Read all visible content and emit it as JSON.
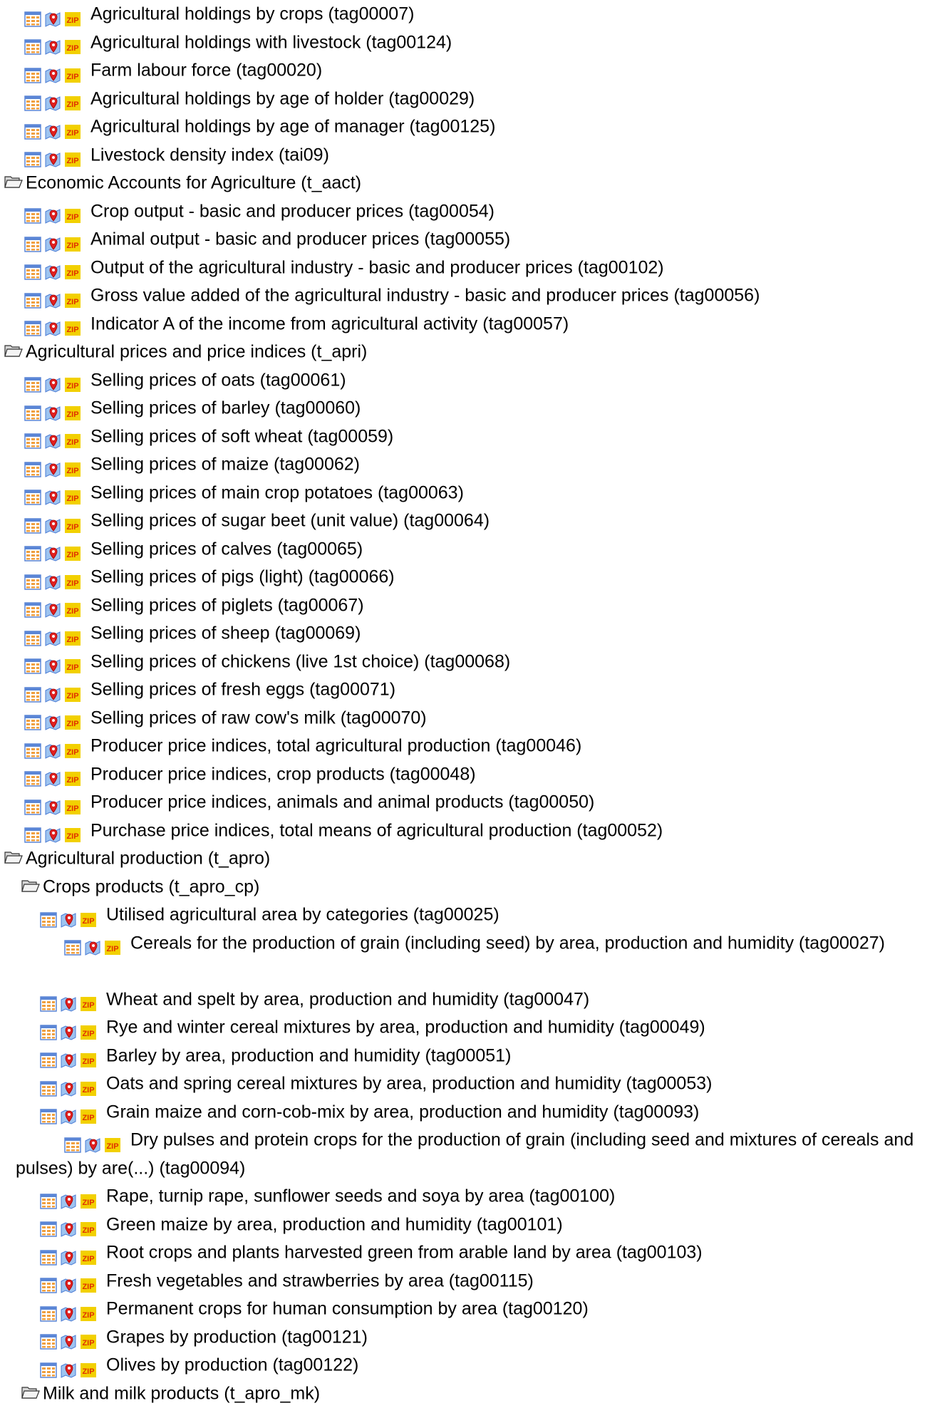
{
  "tree": [
    {
      "type": "leaf",
      "level": 1,
      "label": "Agricultural holdings by crops (tag00007)"
    },
    {
      "type": "leaf",
      "level": 1,
      "label": "Agricultural holdings with livestock (tag00124)"
    },
    {
      "type": "leaf",
      "level": 1,
      "label": "Farm labour force (tag00020)"
    },
    {
      "type": "leaf",
      "level": 1,
      "label": "Agricultural holdings by age of holder (tag00029)"
    },
    {
      "type": "leaf",
      "level": 1,
      "label": "Agricultural holdings by age of manager (tag00125)"
    },
    {
      "type": "leaf",
      "level": 1,
      "label": "Livestock density index (tai09)"
    },
    {
      "type": "folder",
      "level": 0,
      "label": "Economic Accounts for Agriculture (t_aact)"
    },
    {
      "type": "leaf",
      "level": 1,
      "label": "Crop output - basic and producer prices (tag00054)"
    },
    {
      "type": "leaf",
      "level": 1,
      "label": "Animal output - basic and producer prices (tag00055)"
    },
    {
      "type": "leaf",
      "level": 1,
      "label": "Output of the agricultural industry - basic and producer prices (tag00102)"
    },
    {
      "type": "leaf",
      "level": 1,
      "label": "Gross value added of the agricultural industry - basic and producer prices (tag00056)"
    },
    {
      "type": "leaf",
      "level": 1,
      "label": "Indicator A of the income from agricultural activity (tag00057)"
    },
    {
      "type": "folder",
      "level": 0,
      "label": "Agricultural prices and price indices (t_apri)"
    },
    {
      "type": "leaf",
      "level": 1,
      "label": "Selling prices of oats (tag00061)"
    },
    {
      "type": "leaf",
      "level": 1,
      "label": "Selling prices of barley (tag00060)"
    },
    {
      "type": "leaf",
      "level": 1,
      "label": "Selling prices of soft wheat (tag00059)"
    },
    {
      "type": "leaf",
      "level": 1,
      "label": "Selling prices of maize (tag00062)"
    },
    {
      "type": "leaf",
      "level": 1,
      "label": "Selling prices of main crop potatoes (tag00063)"
    },
    {
      "type": "leaf",
      "level": 1,
      "label": "Selling prices of sugar beet (unit value) (tag00064)"
    },
    {
      "type": "leaf",
      "level": 1,
      "label": "Selling prices of calves (tag00065)"
    },
    {
      "type": "leaf",
      "level": 1,
      "label": "Selling prices of pigs (light) (tag00066)"
    },
    {
      "type": "leaf",
      "level": 1,
      "label": "Selling prices of piglets (tag00067)"
    },
    {
      "type": "leaf",
      "level": 1,
      "label": "Selling prices of sheep (tag00069)"
    },
    {
      "type": "leaf",
      "level": 1,
      "label": "Selling prices of chickens (live 1st choice) (tag00068)"
    },
    {
      "type": "leaf",
      "level": 1,
      "label": "Selling prices of fresh eggs (tag00071)"
    },
    {
      "type": "leaf",
      "level": 1,
      "label": "Selling prices of raw cow's milk (tag00070)"
    },
    {
      "type": "leaf",
      "level": 1,
      "label": "Producer price indices, total agricultural production (tag00046)"
    },
    {
      "type": "leaf",
      "level": 1,
      "label": "Producer price indices, crop products (tag00048)"
    },
    {
      "type": "leaf",
      "level": 1,
      "label": "Producer price indices, animals and animal products (tag00050)"
    },
    {
      "type": "leaf",
      "level": 1,
      "label": "Purchase price indices, total means of agricultural production (tag00052)"
    },
    {
      "type": "folder",
      "level": 0,
      "label": "Agricultural production (t_apro)"
    },
    {
      "type": "folder",
      "level": 1,
      "label": "Crops products (t_apro_cp)"
    },
    {
      "type": "leaf",
      "level": 2,
      "label": "Utilised agricultural area by categories (tag00025)"
    },
    {
      "type": "leaf",
      "level": 2,
      "wrap": true,
      "label": "Cereals for the production of grain (including seed) by area, production and humidity (tag00027)"
    },
    {
      "type": "leaf",
      "level": 2,
      "label": "Wheat and spelt  by area, production and humidity (tag00047)"
    },
    {
      "type": "leaf",
      "level": 2,
      "label": "Rye and winter cereal mixtures by area, production and humidity (tag00049)"
    },
    {
      "type": "leaf",
      "level": 2,
      "label": "Barley by area, production and humidity (tag00051)"
    },
    {
      "type": "leaf",
      "level": 2,
      "label": "Oats and spring cereal mixtures by area, production and humidity (tag00053)"
    },
    {
      "type": "leaf",
      "level": 2,
      "label": "Grain maize and corn-cob-mix by area, production and humidity (tag00093)"
    },
    {
      "type": "leaf",
      "level": 2,
      "wrap": true,
      "label": "Dry pulses and protein crops for the production of grain (including seed and mixtures of cereals and pulses) by are(...) (tag00094)"
    },
    {
      "type": "leaf",
      "level": 2,
      "label": "Rape, turnip rape, sunflower seeds and soya by area (tag00100)"
    },
    {
      "type": "leaf",
      "level": 2,
      "label": "Green maize by area, production and humidity (tag00101)"
    },
    {
      "type": "leaf",
      "level": 2,
      "label": "Root crops and plants harvested green from arable land by area (tag00103)"
    },
    {
      "type": "leaf",
      "level": 2,
      "label": "Fresh vegetables and strawberries by area (tag00115)"
    },
    {
      "type": "leaf",
      "level": 2,
      "label": "Permanent crops for human consumption by area (tag00120)"
    },
    {
      "type": "leaf",
      "level": 2,
      "label": "Grapes by production (tag00121)"
    },
    {
      "type": "leaf",
      "level": 2,
      "label": "Olives by production (tag00122)"
    },
    {
      "type": "folder",
      "level": 1,
      "label": "Milk and milk products (t_apro_mk)"
    }
  ],
  "icons": {
    "table": "table-icon",
    "map": "map-icon",
    "zip": "zip-icon",
    "folder": "open-folder-icon"
  },
  "colors": {
    "table_grid": "#4a7bd4",
    "table_cell": "#f0a040",
    "map_pin": "#e02020",
    "zip_bg": "#f2d000",
    "zip_text": "#e03000",
    "folder": "#6e6e6e"
  }
}
